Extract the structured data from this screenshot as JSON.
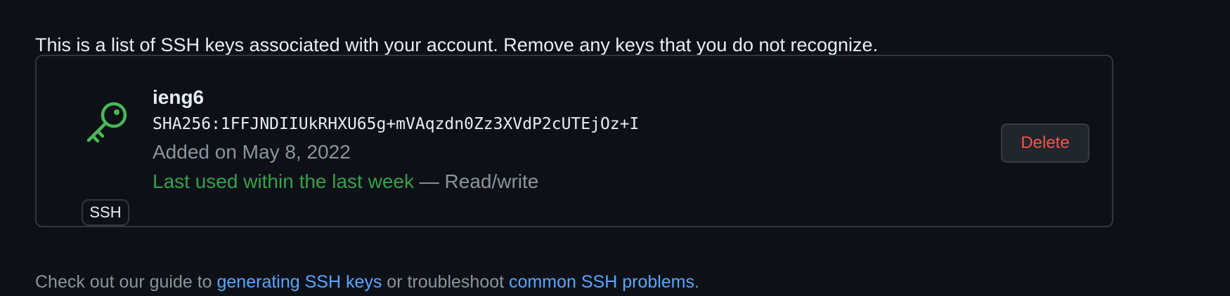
{
  "intro_text": "This is a list of SSH keys associated with your account. Remove any keys that you do not recognize.",
  "keys": [
    {
      "title": "ieng6",
      "type_badge": "SSH",
      "icon": "key-icon",
      "fingerprint": "SHA256:1FFJNDIIUkRHXU65g+mVAqzdn0Zz3XVdP2cUTEjOz+I",
      "added": "Added on May 8, 2022",
      "last_used": "Last used within the last week",
      "access": "— Read/write",
      "delete_label": "Delete"
    }
  ],
  "footer": {
    "prefix": "Check out our guide to ",
    "link1": "generating SSH keys",
    "middle": " or troubleshoot ",
    "link2": "common SSH problems",
    "suffix": "."
  },
  "colors": {
    "background": "#0d1117",
    "border": "#30363d",
    "text_primary": "#e6edf3",
    "text_muted": "#8b949e",
    "recent_green": "#3fb950",
    "danger": "#f85149",
    "link": "#58a6ff"
  }
}
